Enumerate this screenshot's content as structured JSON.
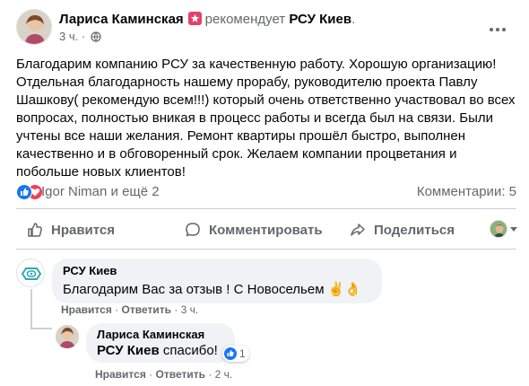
{
  "post": {
    "author": "Лариса Каминская",
    "recommends": "рекомендует",
    "page": "РСУ Киев",
    "dot": ".",
    "time": "3 ч.",
    "time_sep": "·",
    "body": "Благодарим компанию РСУ за качественную работу. Хорошую организацию! Отдельная благодарность нашему прорабу, руководителю проекта Павлу Шашкову( рекомендую всем!!!) который очень ответственно участвовал во всех вопросах, полностью вникая в процесс работы и всегда был на связи. Были учтены все наши желания. Ремонт квартиры прошёл быстро, выполнен качественно и в обговоренный срок. Желаем компании процветания и побольше новых клиентов!",
    "reactions_text": "Igor Niman и ещё 2",
    "comments_count": "Комментарии: 5"
  },
  "actions": {
    "like": "Нравится",
    "comment": "Комментировать",
    "share": "Поделиться"
  },
  "comments": [
    {
      "author": "РСУ Киев",
      "text": "Благодарим Вас за отзыв ! С Новосельем ✌️👌",
      "like": "Нравится",
      "reply": "Ответить",
      "sep": "·",
      "time": "3 ч."
    },
    {
      "author": "Лариса Каминская",
      "reply_to": "РСУ Киев",
      "text": "спасибо!",
      "reaction_count": "1",
      "like": "Нравится",
      "reply": "Ответить",
      "sep": "·",
      "time": "2 ч."
    }
  ],
  "colors": {
    "link_blue": "#1877f2",
    "muted": "#65676b",
    "bubble": "#f0f2f5",
    "love_red": "#f33e58",
    "badge_pink": "#e4416b"
  },
  "icons": [
    "globe-icon",
    "more-icon",
    "like-icon",
    "comment-icon",
    "share-icon",
    "star-badge-icon"
  ]
}
